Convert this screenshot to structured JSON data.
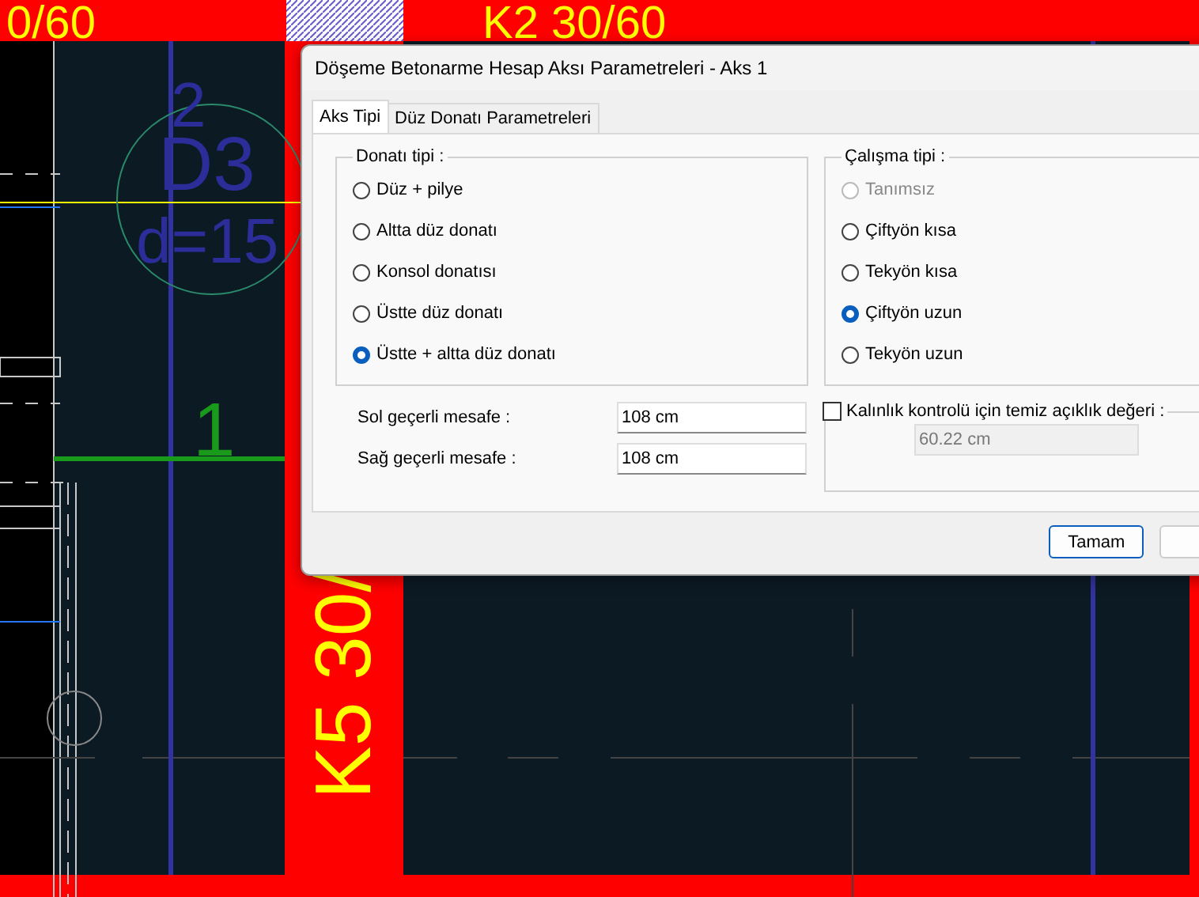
{
  "drawing": {
    "column_label_top_left": "0/60",
    "column_label_top": "K2 30/60",
    "column_label_vertical": "K5 30/",
    "slab_number": "2",
    "slab_name": "D3",
    "slab_thickness": "d=15",
    "axis_number": "1"
  },
  "dialog": {
    "title": "Döşeme Betonarme Hesap Aksı Parametreleri - Aks 1",
    "tabs": [
      {
        "label": "Aks Tipi",
        "selected": true
      },
      {
        "label": "Düz Donatı Parametreleri",
        "selected": false
      }
    ],
    "rebar_group": {
      "legend": "Donatı tipi :",
      "options": [
        {
          "label": "Düz + pilye",
          "selected": false
        },
        {
          "label": "Altta düz donatı",
          "selected": false
        },
        {
          "label": "Konsol donatısı",
          "selected": false
        },
        {
          "label": "Üstte düz donatı",
          "selected": false
        },
        {
          "label": "Üstte + altta düz donatı",
          "selected": true
        }
      ]
    },
    "distances": [
      {
        "label": "Sol geçerli mesafe :",
        "value": "108 cm"
      },
      {
        "label": "Sağ geçerli mesafe :",
        "value": "108 cm"
      }
    ],
    "work_group": {
      "legend": "Çalışma tipi :",
      "options": [
        {
          "label": "Tanımsız",
          "selected": false,
          "disabled": true
        },
        {
          "label": "Çiftyön kısa",
          "selected": false,
          "disabled": false
        },
        {
          "label": "Tekyön kısa",
          "selected": false,
          "disabled": false
        },
        {
          "label": "Çiftyön uzun",
          "selected": true,
          "disabled": false
        },
        {
          "label": "Tekyön uzun",
          "selected": false,
          "disabled": false
        }
      ]
    },
    "thickness_check": {
      "label": "Kalınlık kontrolü için temiz açıklık değeri :",
      "checked": false,
      "value": "60.22 cm"
    },
    "buttons": [
      "Tamam"
    ]
  }
}
